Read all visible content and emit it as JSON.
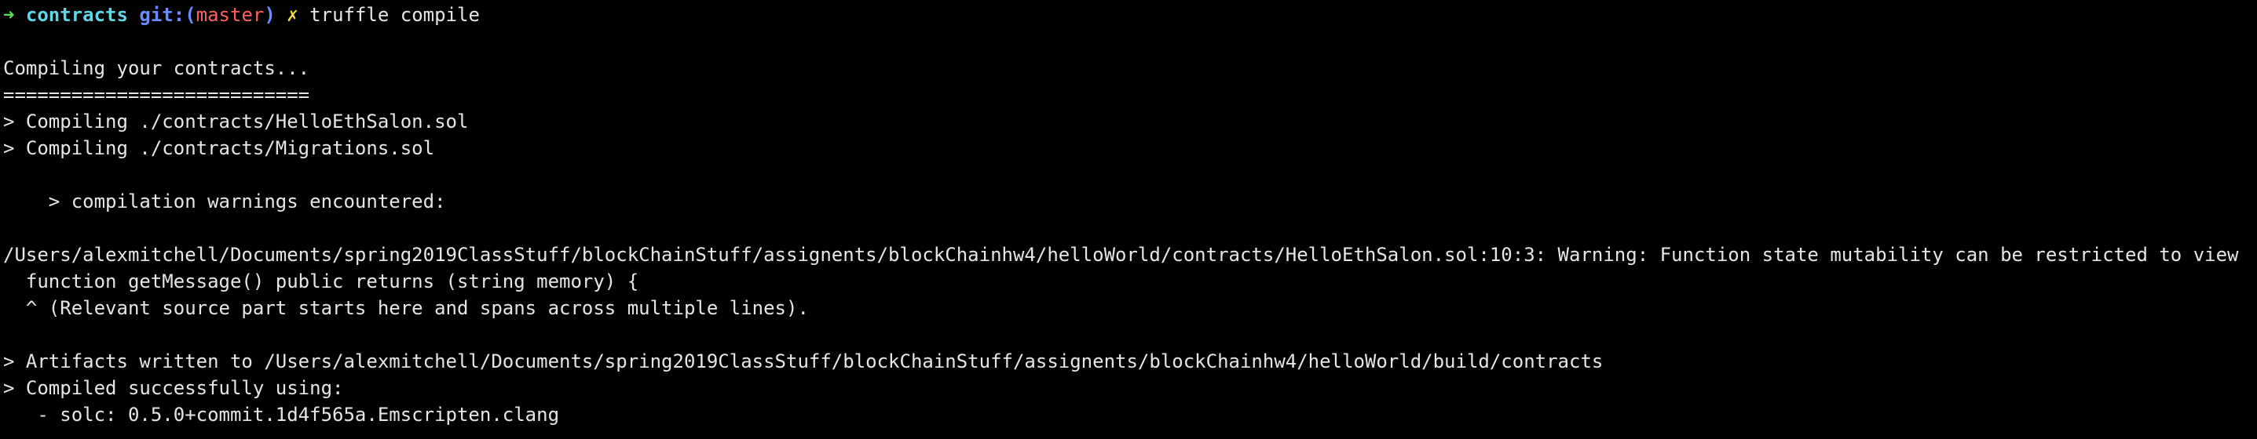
{
  "prompt": {
    "arrow": "➜",
    "directory": "contracts",
    "git_prefix": "git:(",
    "branch": "master",
    "git_suffix": ")",
    "dirty_marker": "✗",
    "command": "truffle compile"
  },
  "output": {
    "compiling_header": "Compiling your contracts...",
    "separator": "===========================",
    "compile_1": "> Compiling ./contracts/HelloEthSalon.sol",
    "compile_2": "> Compiling ./contracts/Migrations.sol",
    "warnings_header": "    > compilation warnings encountered:",
    "warning_path": "/Users/alexmitchell/Documents/spring2019ClassStuff/blockChainStuff/assignents/blockChainhw4/helloWorld/contracts/HelloEthSalon.sol:10:3: Warning: Function state mutability can be restricted to view",
    "warning_code": "  function getMessage() public returns (string memory) {",
    "warning_caret": "  ^ (Relevant source part starts here and spans across multiple lines).",
    "artifacts": "> Artifacts written to /Users/alexmitchell/Documents/spring2019ClassStuff/blockChainStuff/assignents/blockChainhw4/helloWorld/build/contracts",
    "compiled_ok": "> Compiled successfully using:",
    "solc": "   - solc: 0.5.0+commit.1d4f565a.Emscripten.clang"
  },
  "colors": {
    "background": "#000000",
    "text": "#e6e6e6",
    "arrow": "#56e05a",
    "directory": "#5fd7e8",
    "git": "#6b8cff",
    "branch": "#ff5f5f",
    "dirty": "#f0e040"
  }
}
